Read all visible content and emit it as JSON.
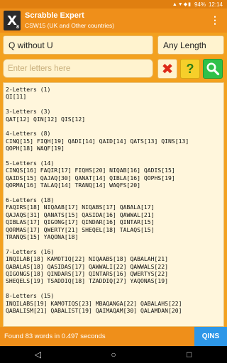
{
  "statusbar": {
    "battery": "94%",
    "time": "12:14",
    "icons": "▲▼◆▮"
  },
  "app": {
    "logo_letter": "X",
    "logo_sub": "8",
    "title": "Scrabble Expert",
    "subtitle": "CSW15 (UK and Other countries)",
    "menu_icon": "⋮"
  },
  "search": {
    "value": "Q without U"
  },
  "length": {
    "value": "Any Length"
  },
  "letters": {
    "placeholder": "Enter letters here"
  },
  "buttons": {
    "clear_glyph": "✖",
    "help_glyph": "?",
    "search_icon": "search-icon"
  },
  "results": {
    "groups": [
      {
        "heading": "2-Letters (1)",
        "lines": [
          "QI[11]"
        ]
      },
      {
        "heading": "3-Letters (3)",
        "lines": [
          "QAT[12] QIN[12] QIS[12]"
        ]
      },
      {
        "heading": "4-Letters (8)",
        "lines": [
          "CINQ[15] FIQH[19] QADI[14] QAID[14] QATS[13] QINS[13]",
          "QOPH[18] WAQF[19]"
        ]
      },
      {
        "heading": "5-Letters (14)",
        "lines": [
          "CINQS[16] FAQIR[17] FIQHS[20] NIQAB[16] QADIS[15]",
          "QAIDS[15] QAJAQ[30] QANAT[14] QIBLA[16] QOPHS[19]",
          "QORMA[16] TALAQ[14] TRANQ[14] WAQFS[20]"
        ]
      },
      {
        "heading": "6-Letters (18)",
        "lines": [
          "FAQIRS[18] NIQAAB[17] NIQABS[17] QABALA[17]",
          "QAJAQS[31] QANATS[15] QASIDA[16] QAWWAL[21]",
          "QIBLAS[17] QIGONG[17] QINDAR[16] QINTAR[15]",
          "QORMAS[17] QWERTY[21] SHEQEL[18] TALAQS[15]",
          "TRANQS[15] YAQONA[18]"
        ]
      },
      {
        "heading": "7-Letters (16)",
        "lines": [
          "INQILAB[18] KAMOTIQ[22] NIQAABS[18] QABALAH[21]",
          "QABALAS[18] QASIDAS[17] QAWWALI[22] QAWWALS[22]",
          "QIGONGS[18] QINDARS[17] QINTARS[16] QWERTYS[22]",
          "SHEQELS[19] TSADDIQ[18] TZADDIQ[27] YAQONAS[19]"
        ]
      },
      {
        "heading": "8-Letters (15)",
        "lines": [
          "INQILABS[19] KAMOTIQS[23] MBAQANGA[22] QABALAHS[22]",
          "QABALISM[21] QABALIST[19] QAIMAQAM[30] QALAMDAN[20]"
        ]
      }
    ]
  },
  "footer": {
    "status": "Found 83 words in 0.497 seconds",
    "button": "QINS"
  },
  "navbar": {
    "back": "◁",
    "home": "○",
    "recents": "□"
  }
}
